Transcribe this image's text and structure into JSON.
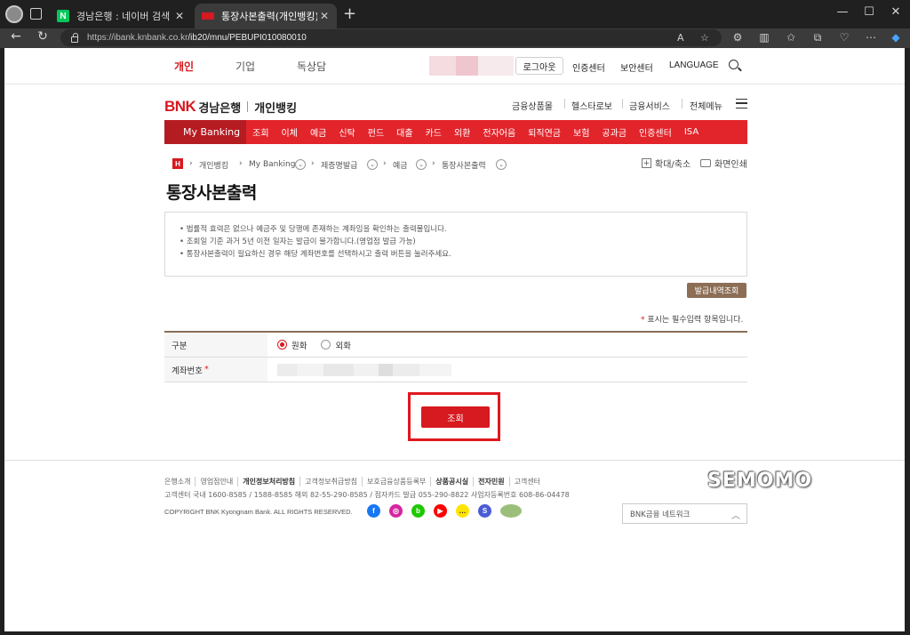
{
  "browser": {
    "tabs": [
      {
        "title": "경남은행 : 네이버 검색",
        "favicon": "naver-icon",
        "favicon_letter": "N"
      },
      {
        "title": "통장사본출력(개인뱅킹) | My Bank",
        "favicon": "bnk-icon"
      }
    ],
    "url_host": "https://ibank.knbank.co.kr",
    "url_path": "/ib20/mnu/PEBUPI010080010"
  },
  "gnb": {
    "items": [
      "개인",
      "기업",
      "독상담"
    ],
    "active": "개인",
    "login_label": "로그아웃",
    "utils": [
      "인증센터",
      "보안센터",
      "LANGUAGE"
    ]
  },
  "header": {
    "logo_brand": "BNK",
    "logo_bank": "경남은행",
    "logo_sub": "개인뱅킹",
    "topnav": [
      "금융상품몰",
      "헬스타로보",
      "금융서비스",
      "전체메뉴"
    ]
  },
  "mainmenu": [
    "My Banking",
    "조회",
    "이체",
    "예금",
    "신탁",
    "펀드",
    "대출",
    "카드",
    "외환",
    "전자어음",
    "퇴직연금",
    "보험",
    "공과금",
    "인증센터",
    "ISA"
  ],
  "breadcrumb": {
    "home_letter": "H",
    "items": [
      "개인뱅킹",
      "My Banking",
      "제증명발급",
      "예금",
      "통장사본출력"
    ]
  },
  "tools": {
    "zoom": "확대/축소",
    "print": "화면인쇄"
  },
  "page_title": "통장사본출력",
  "notice": [
    "• 법률적 효력은 없으나 예금주 및 당행에 존재하는 계좌임을 확인하는 출력물입니다.",
    "• 조회일 기준 과거 5년 이전 일자는 발급이 불가합니다.(영업점 발급 가능)",
    "• 통장사본출력이 필요하신 경우 해당 계좌번호를 선택하시고 출력 버튼을 눌러주세요."
  ],
  "history_button": "발급내역조회",
  "required_note": {
    "star": "*",
    "text": " 표시는 필수입력 항목입니다."
  },
  "form": {
    "type_label": "구분",
    "type_options": [
      {
        "label": "원화",
        "checked": true
      },
      {
        "label": "외화",
        "checked": false
      }
    ],
    "account_label": "계좌번호",
    "required_star": "*"
  },
  "search_button": "조회",
  "footer": {
    "links": [
      {
        "text": "은행소개",
        "bold": false
      },
      {
        "text": "영업점안내",
        "bold": false
      },
      {
        "text": "개인정보처리방침",
        "bold": true
      },
      {
        "text": "고객정보취급방침",
        "bold": false
      },
      {
        "text": "보호금융상품등록부",
        "bold": false
      },
      {
        "text": "상품공시실",
        "bold": true
      },
      {
        "text": "전자민원",
        "bold": true
      },
      {
        "text": "고객센터",
        "bold": false
      }
    ],
    "contact": "고객센터 국내 1600-8585 / 1588-8585 해외 82-55-290-8585 / 점자카드 발급 055-290-8822 사업자등록번호 608-86-04478",
    "copyright": "COPYRIGHT BNK Kyongnam Bank. ALL RIGHTS RESERVED.",
    "sns": [
      {
        "name": "facebook-icon",
        "color": "#1877f2",
        "glyph": "f"
      },
      {
        "name": "instagram-icon",
        "color": "#d6249f",
        "glyph": "◎"
      },
      {
        "name": "band-icon",
        "color": "#1ec800",
        "glyph": "b"
      },
      {
        "name": "youtube-icon",
        "color": "#ff0000",
        "glyph": "▶"
      },
      {
        "name": "kakaotalk-icon",
        "color": "#fee500",
        "glyph": "…"
      },
      {
        "name": "kakaostory-icon",
        "color": "#4a5cd6",
        "glyph": "S"
      },
      {
        "name": "webaward-icon",
        "color": "#9bbf7a",
        "glyph": ""
      }
    ],
    "network_select": "BNK금융 네트워크"
  },
  "watermark": "SEMOMO",
  "colors": {
    "brand_red": "#d71920",
    "menu_red": "#e2242b",
    "brown": "#8c6d55"
  }
}
